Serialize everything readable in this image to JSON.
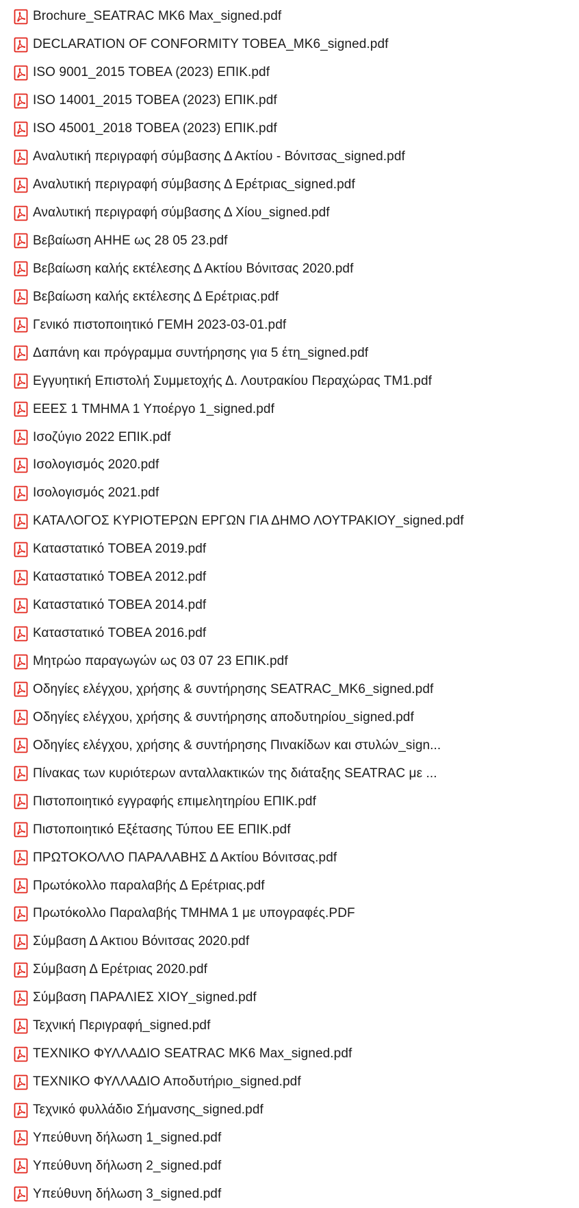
{
  "icon": "pdf-document-icon",
  "accent_color": "#e2231a",
  "files": [
    "Brochure_SEATRAC MK6 Max_signed.pdf",
    "DECLARATION  OF CONFORMITY TOBEA_MK6_signed.pdf",
    "ISO 9001_2015 TOBEA (2023) ΕΠΙΚ.pdf",
    "ISO 14001_2015 TOBEA (2023)  ΕΠΙΚ.pdf",
    "ISO 45001_2018 TOBEA (2023) ΕΠΙΚ.pdf",
    "Αναλυτική περιγραφή σύμβασης Δ Ακτίου - Βόνιτσας_signed.pdf",
    "Αναλυτική περιγραφή σύμβασης Δ Ερέτριας_signed.pdf",
    "Αναλυτική περιγραφή σύμβασης Δ Χίου_signed.pdf",
    "Βεβαίωση ΑΗΗΕ ως 28 05 23.pdf",
    "Βεβαίωση καλής εκτέλεσης Δ Ακτίου Βόνιτσας 2020.pdf",
    "Βεβαίωση καλής εκτέλεσης Δ Ερέτριας.pdf",
    "Γενικό πιστοποιητικό ΓΕΜΗ 2023-03-01.pdf",
    "Δαπάνη και πρόγραμμα συντήρησης για 5 έτη_signed.pdf",
    "Εγγυητική Επιστολή Συμμετοχής Δ. Λουτρακίου Περαχώρας ΤΜ1.pdf",
    "ΕΕΕΣ 1 ΤΜΗΜΑ 1 Υποέργο 1_signed.pdf",
    "Ισοζύγιο 2022 ΕΠΙΚ.pdf",
    "Ισολογισμός 2020.pdf",
    "Ισολογισμός 2021.pdf",
    "ΚΑΤΑΛΟΓΟΣ ΚΥΡΙΟΤΕΡΩΝ ΕΡΓΩΝ ΓΙΑ ΔΗΜΟ ΛΟΥΤΡΑΚΙΟΥ_signed.pdf",
    "Καταστατικό TOBEA 2019.pdf",
    "Καταστατικό TOBEA 2012.pdf",
    "Καταστατικό TOBEA 2014.pdf",
    "Καταστατικό TOBEA 2016.pdf",
    "Μητρώο παραγωγών ως 03 07 23 ΕΠΙΚ.pdf",
    "Οδηγίες ελέγχου, χρήσης & συντήρησης SEATRAC_MK6_signed.pdf",
    "Οδηγίες ελέγχου, χρήσης & συντήρησης αποδυτηρίου_signed.pdf",
    "Οδηγίες ελέγχου, χρήσης & συντήρησης Πινακίδων και στυλών_sign...",
    "Πίνακας των κυριότερων ανταλλακτικών της διάταξης SEATRAC με ...",
    "Πιστοποιητικό εγγραφής επιμελητηρίου ΕΠΙΚ.pdf",
    "Πιστοποιητικό Εξέτασης Τύπου ΕΕ ΕΠΙΚ.pdf",
    "ΠΡΩΤΟΚΟΛΛΟ ΠΑΡΑΛΑΒΗΣ Δ Ακτίου Βόνιτσας.pdf",
    "Πρωτόκολλο παραλαβής Δ Ερέτριας.pdf",
    "Πρωτόκολλο Παραλαβής ΤΜΗΜΑ 1 με υπογραφές.PDF",
    "Σύμβαση Δ Ακτιου Βόνιτσας 2020.pdf",
    "Σύμβαση Δ Ερέτριας 2020.pdf",
    "Σύμβαση ΠΑΡΑΛΙΕΣ ΧΙΟΥ_signed.pdf",
    "Τεχνική Περιγραφή_signed.pdf",
    "ΤΕΧΝΙΚΟ ΦΥΛΛΑΔΙΟ SEATRAC MK6 Max_signed.pdf",
    "ΤΕΧΝΙΚΟ ΦΥΛΛΑΔΙΟ Αποδυτήριο_signed.pdf",
    "Τεχνικό φυλλάδιο Σήμανσης_signed.pdf",
    "Υπεύθυνη δήλωση 1_signed.pdf",
    "Υπεύθυνη δήλωση 2_signed.pdf",
    "Υπεύθυνη δήλωση 3_signed.pdf"
  ]
}
